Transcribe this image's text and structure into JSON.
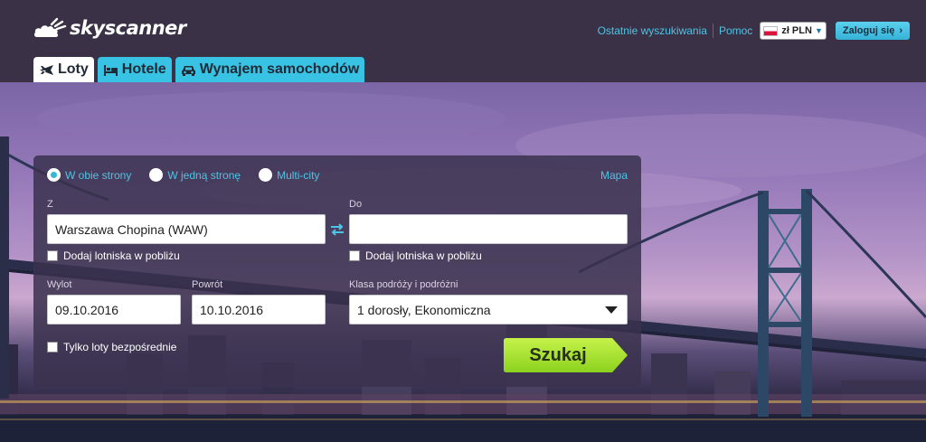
{
  "brand": {
    "name": "skyscanner"
  },
  "header": {
    "links": [
      "Ostatnie wyszukiwania",
      "Pomoc"
    ],
    "currency": "zł PLN",
    "login": "Zaloguj się"
  },
  "tabs": [
    {
      "label": "Loty",
      "icon": "plane-icon",
      "active": true
    },
    {
      "label": "Hotele",
      "icon": "bed-icon",
      "active": false
    },
    {
      "label": "Wynajem samochodów",
      "icon": "car-icon",
      "active": false
    }
  ],
  "search": {
    "trip_types": [
      "W obie strony",
      "W jedną stronę",
      "Multi-city"
    ],
    "selected_trip_type": "W obie strony",
    "map_link": "Mapa",
    "from_label": "Z",
    "from_value": "Warszawa Chopina (WAW)",
    "to_label": "Do",
    "to_value": "",
    "nearby_from": "Dodaj lotniska w pobliżu",
    "nearby_to": "Dodaj lotniska w pobliżu",
    "depart_label": "Wylot",
    "depart_value": "09.10.2016",
    "return_label": "Powrót",
    "return_value": "10.10.2016",
    "class_label": "Klasa podróży i podróżni",
    "class_value": "1 dorosły, Ekonomiczna",
    "direct_only": "Tylko loty bezpośrednie",
    "submit": "Szukaj"
  },
  "colors": {
    "header_bg": "#3a3147",
    "accent": "#4fc3e3",
    "tab_inactive": "#38c2e4",
    "search_button": "#9be02a"
  }
}
